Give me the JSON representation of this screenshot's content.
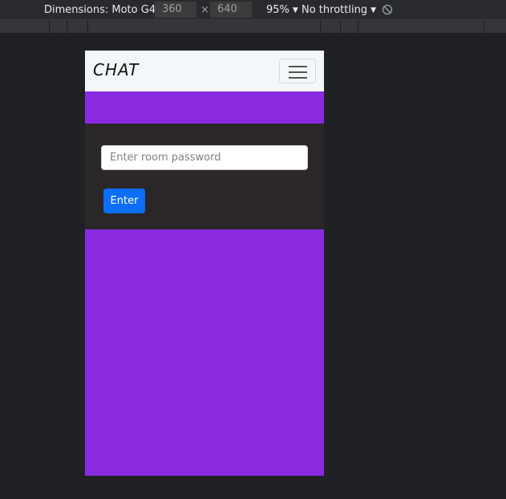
{
  "devtools": {
    "dimensions_label": "Dimensions: Moto G4",
    "width_value": "360",
    "times": "×",
    "height_value": "640",
    "zoom_label": "95%",
    "throttle_label": "No throttling",
    "dropdown_arrow": "▼"
  },
  "app": {
    "brand": "CHAT",
    "password_placeholder": "Enter room password",
    "enter_label": "Enter",
    "colors": {
      "page_background": "#8a2be2",
      "card_background": "#2b2628",
      "navbar_background": "#f4f7f9",
      "button": "#0d6efd"
    }
  }
}
